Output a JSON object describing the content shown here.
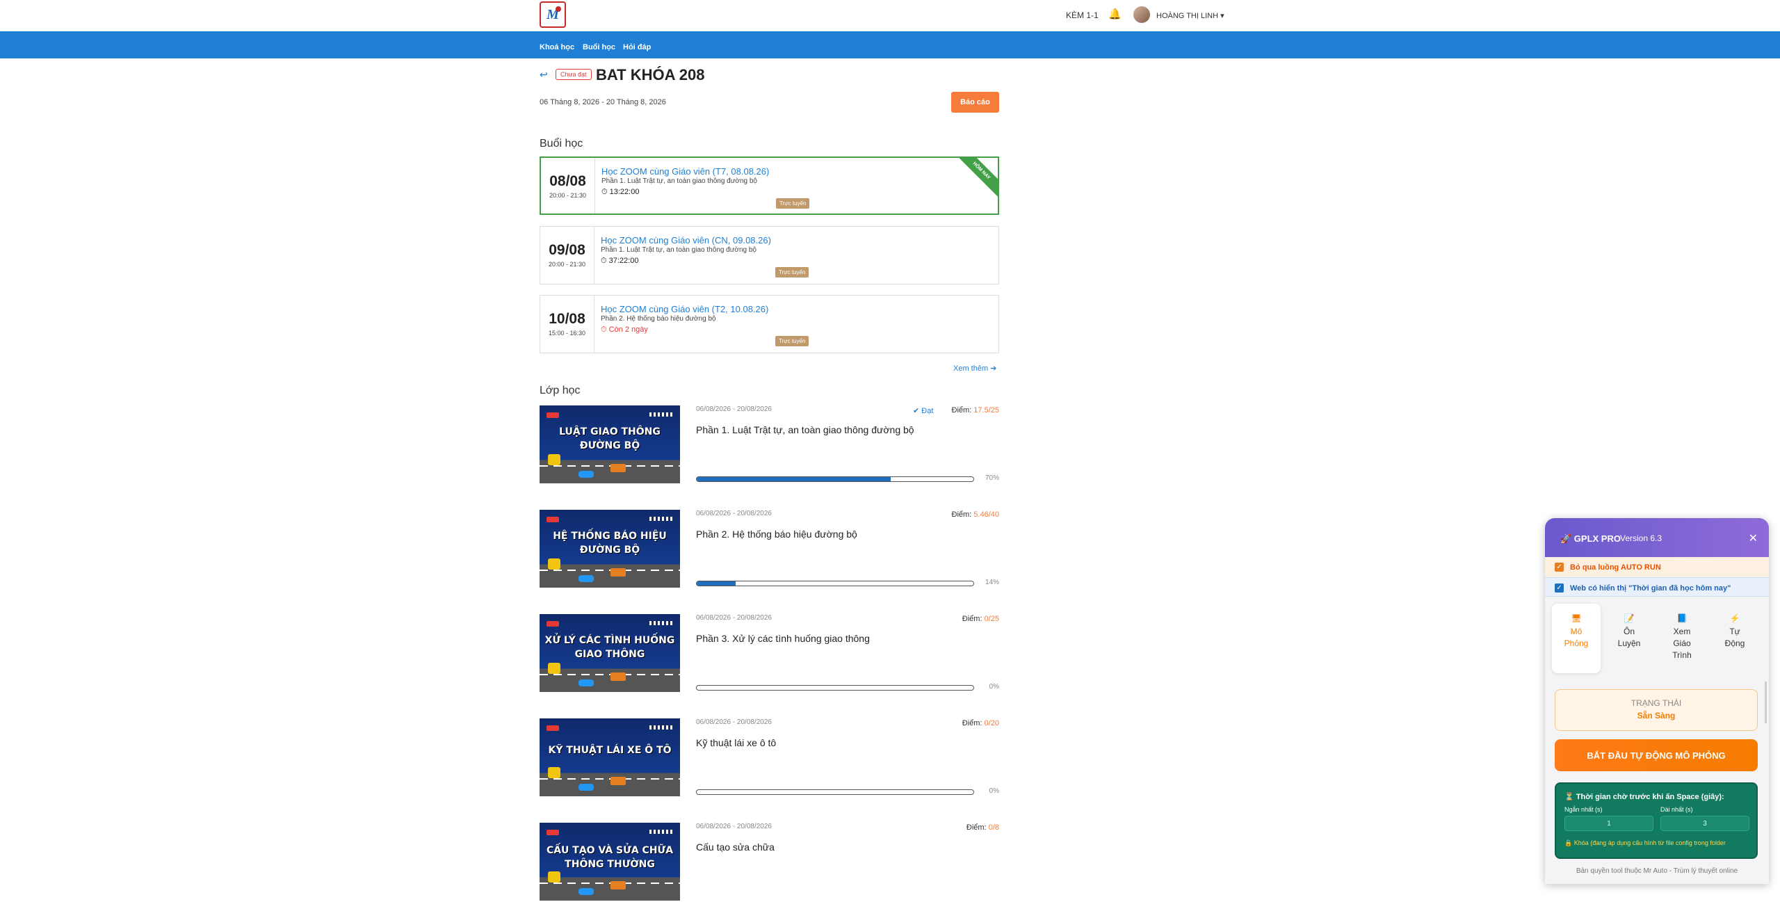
{
  "header": {
    "logo_text": "M",
    "kem_label": "KÈM 1-1",
    "user_name": "HOÀNG THỊ LINH ▾"
  },
  "nav": {
    "items": [
      "Khoá học",
      "Buổi học",
      "Hỏi đáp"
    ]
  },
  "course": {
    "status_badge": "Chưa đạt",
    "title": "BAT KHÓA 208",
    "dates": "06 Tháng 8, 2026 - 20 Tháng 8, 2026",
    "report_button": "Báo cáo"
  },
  "sessions_section": {
    "title": "Buổi học",
    "see_more": "Xem thêm ➔",
    "items": [
      {
        "day": "08/08",
        "time": "20:00 - 21:30",
        "title": "Học ZOOM cùng Giáo viên (T7, 08.08.26)",
        "subtitle": "Phần 1. Luật Trật tự, an toàn giao thông đường bộ",
        "timer": "13:22:00",
        "tag": "Trực tuyến",
        "ribbon": "HÔM NAY"
      },
      {
        "day": "09/08",
        "time": "20:00 - 21:30",
        "title": "Học ZOOM cùng Giáo viên (CN, 09.08.26)",
        "subtitle": "Phần 1. Luật Trật tự, an toàn giao thông đường bộ",
        "timer": "37:22:00",
        "tag": "Trực tuyến"
      },
      {
        "day": "10/08",
        "time": "15:00 - 16:30",
        "title": "Học ZOOM cùng Giáo viên (T2, 10.08.26)",
        "subtitle": "Phần 2. Hệ thống báo hiệu đường bộ",
        "timer": "Còn 2 ngày",
        "tag": "Trực tuyến"
      }
    ]
  },
  "classes_section": {
    "title": "Lớp học",
    "items": [
      {
        "thumb_line1": "LUẬT GIAO THÔNG",
        "thumb_line2": "ĐƯỜNG BỘ",
        "date": "06/08/2026 - 20/08/2026",
        "pass": "Đạt",
        "score_label": "Điểm:",
        "score": "17.5/25",
        "name": "Phần 1. Luật Trật tự, an toàn giao thông đường bộ",
        "progress": 70,
        "progress_text": "70%"
      },
      {
        "thumb_line1": "HỆ THỐNG BÁO HIỆU",
        "thumb_line2": "ĐƯỜNG BỘ",
        "date": "06/08/2026 - 20/08/2026",
        "pass": "",
        "score_label": "Điểm:",
        "score": "5.46/40",
        "name": "Phần 2. Hệ thống báo hiệu đường bộ",
        "progress": 14,
        "progress_text": "14%"
      },
      {
        "thumb_line1": "XỬ LÝ CÁC TÌNH HUỐNG",
        "thumb_line2": "GIAO THÔNG",
        "date": "06/08/2026 - 20/08/2026",
        "pass": "",
        "score_label": "Điểm:",
        "score": "0/25",
        "name": "Phần 3. Xử lý các tình huống giao thông",
        "progress": 0,
        "progress_text": "0%"
      },
      {
        "thumb_line1": "KỸ THUẬT LÁI XE Ô TÔ",
        "thumb_line2": "",
        "date": "06/08/2026 - 20/08/2026",
        "pass": "",
        "score_label": "Điểm:",
        "score": "0/20",
        "name": "Kỹ thuật lái xe ô tô",
        "progress": 0,
        "progress_text": "0%"
      },
      {
        "thumb_line1": "CẤU TẠO VÀ SỬA CHỮA",
        "thumb_line2": "THÔNG THƯỜNG",
        "date": "06/08/2026 - 20/08/2026",
        "pass": "",
        "score_label": "Điểm:",
        "score": "0/8",
        "name": "Cấu tạo sửa chữa",
        "progress": 0,
        "progress_text": ""
      }
    ]
  },
  "widget": {
    "title": "🚀 GPLX PRO",
    "version": "Version 6.3",
    "close": "✕",
    "opt1": "Bỏ qua luồng AUTO RUN",
    "opt2": "Web có hiển thị \"Thời gian đã học hôm nay\"",
    "tabs": [
      {
        "icon": "🖥",
        "label": "Mô Phỏng"
      },
      {
        "icon": "📝",
        "label": "Ôn Luyện"
      },
      {
        "icon": "📘",
        "label": "Xem Giáo Trình"
      },
      {
        "icon": "⚡",
        "label": "Tự Động"
      }
    ],
    "status_label": "TRẠNG THÁI",
    "status_value": "Sẵn Sàng",
    "start_button": "BẮT ĐẦU TỰ ĐỘNG MÔ PHỎNG",
    "wait_title": "⏳ Thời gian chờ trước khi ấn Space (giây):",
    "min_label": "Ngắn nhất (s)",
    "max_label": "Dài nhất (s)",
    "min_value": "1",
    "max_value": "3",
    "lock_note": "🔒 Khóa (đang áp dụng cấu hình từ file config trong folder",
    "footer": "Bản quyền tool thuộc Mr Auto - Trùm lý thuyết online"
  }
}
